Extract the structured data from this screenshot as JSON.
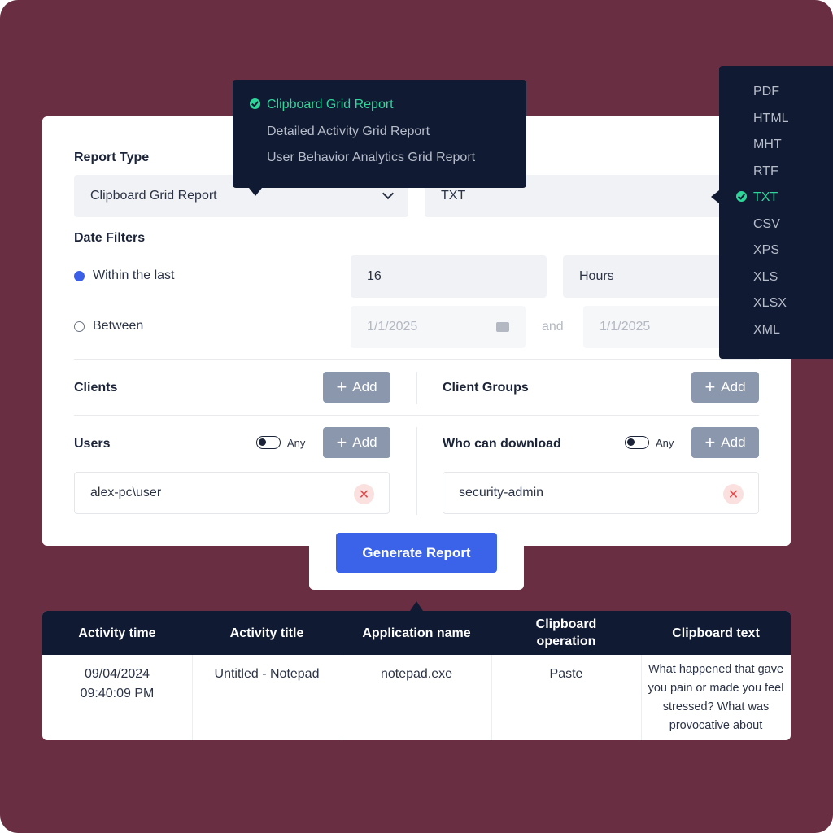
{
  "report_type": {
    "label": "Report Type",
    "selected": "Clipboard Grid Report",
    "options": [
      {
        "label": "Clipboard Grid Report",
        "selected": true
      },
      {
        "label": "Detailed Activity Grid Report",
        "selected": false
      },
      {
        "label": "User Behavior Analytics Grid Report",
        "selected": false
      }
    ]
  },
  "format": {
    "selected": "TXT",
    "options": [
      {
        "label": "PDF",
        "selected": false
      },
      {
        "label": "HTML",
        "selected": false
      },
      {
        "label": "MHT",
        "selected": false
      },
      {
        "label": "RTF",
        "selected": false
      },
      {
        "label": "TXT",
        "selected": true
      },
      {
        "label": "CSV",
        "selected": false
      },
      {
        "label": "XPS",
        "selected": false
      },
      {
        "label": "XLS",
        "selected": false
      },
      {
        "label": "XLSX",
        "selected": false
      },
      {
        "label": "XML",
        "selected": false
      }
    ]
  },
  "date_filters": {
    "label": "Date Filters",
    "within_last": {
      "label": "Within the last",
      "checked": true,
      "value": "16",
      "unit": "Hours"
    },
    "between": {
      "label": "Between",
      "checked": false,
      "from": "1/1/2025",
      "and_label": "and",
      "to": "1/1/2025"
    }
  },
  "clients": {
    "label": "Clients",
    "add_label": "Add"
  },
  "client_groups": {
    "label": "Client Groups",
    "add_label": "Add"
  },
  "users": {
    "label": "Users",
    "any_label": "Any",
    "add_label": "Add",
    "items": [
      "alex-pc\\user"
    ]
  },
  "who_can_download": {
    "label": "Who can download",
    "any_label": "Any",
    "add_label": "Add",
    "items": [
      "security-admin"
    ]
  },
  "generate_label": "Generate Report",
  "table": {
    "headers": [
      "Activity time",
      "Activity title",
      "Application name",
      "Clipboard operation",
      "Clipboard text"
    ],
    "rows": [
      {
        "activity_date": "09/04/2024",
        "activity_clock": "09:40:09 PM",
        "title": "Untitled - Notepad",
        "application": "notepad.exe",
        "operation": "Paste",
        "text": "What happened that gave you pain or made you feel stressed? What was provocative about"
      }
    ]
  },
  "colors": {
    "background": "#6a2e42",
    "popover": "#101a33",
    "accent": "#3b63ea",
    "selected": "#2fd69a",
    "add_button": "#8b97ac"
  }
}
